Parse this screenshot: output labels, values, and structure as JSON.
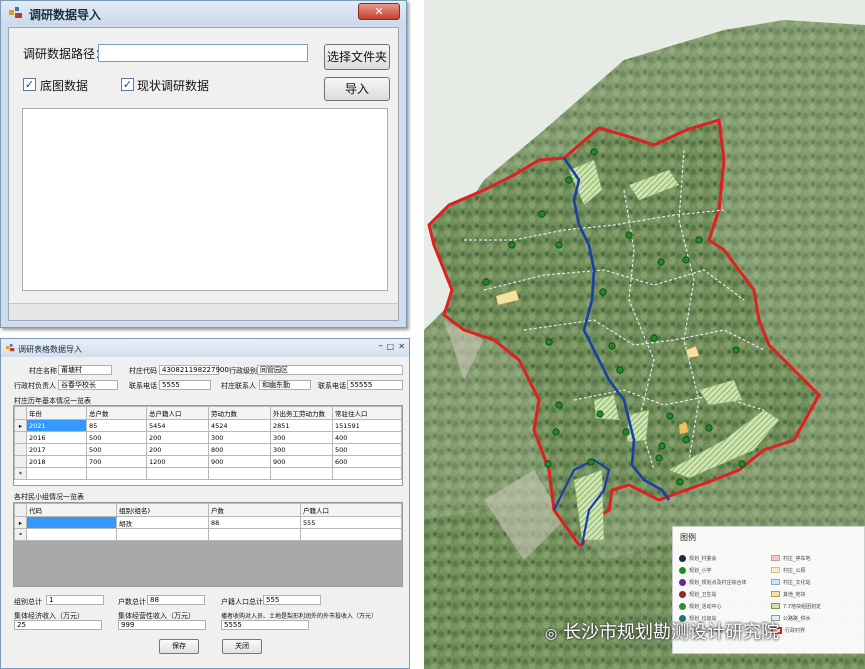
{
  "import_dialog": {
    "title": "调研数据导入",
    "path_label": "调研数据路径：",
    "path_value": "",
    "choose_folder_button": "选择文件夹",
    "import_button": "导入",
    "checkbox_base_map": {
      "label": "底图数据",
      "checked": true
    },
    "checkbox_survey": {
      "label": "现状调研数据",
      "checked": true
    }
  },
  "form_dialog": {
    "title": "调研表格数据导入",
    "village_name_label": "村庄名称",
    "village_name": "莆塘村",
    "village_code_label": "村庄代码",
    "village_code": "430821198227900",
    "admin_label": "行政级别",
    "admin_value": "同管园区",
    "leader_label": "行政村负责人",
    "leader_value": "谷春华校长",
    "phone_label": "联系电话",
    "phone_value": "5555",
    "contact_label": "村庄联系人",
    "contact_value": "和幽东勤",
    "contact_phone_label": "联系电话",
    "contact_phone_value": "55555",
    "table1_title": "村庄历年基本情况一览表",
    "table1_headers": [
      "年份",
      "总户数",
      "总户籍人口",
      "劳动力数",
      "外出务工劳动力数",
      "常驻住人口"
    ],
    "table1_rows": [
      [
        "2021",
        "85",
        "5454",
        "4524",
        "2851",
        "151591"
      ],
      [
        "2016",
        "500",
        "200",
        "300",
        "300",
        "400"
      ],
      [
        "2017",
        "500",
        "200",
        "800",
        "300",
        "500"
      ],
      [
        "2018",
        "700",
        "1200",
        "900",
        "900",
        "600"
      ]
    ],
    "table2_title": "各村民小组情况一览表",
    "table2_headers": [
      "代码",
      "组别(组名)",
      "户数",
      "户籍人口"
    ],
    "table2_rows": [
      [
        "",
        "胡孜",
        "88",
        "555"
      ]
    ],
    "group_total_label": "组别总计",
    "group_total": "1",
    "household_total_label": "户数总计",
    "household_total": "88",
    "population_total_label": "户籍人口总计",
    "population_total": "555",
    "collective_income_label": "集体经济收入（万元）",
    "collective_income": "25",
    "collective_operating_label": "集体经营性收入（万元）",
    "collective_operating": "999",
    "other_income_label": "播者收购对入员、土地是梨形利润外的外市投收入（万元）",
    "other_income": "5555",
    "save_button": "保存",
    "close_button": "关闭"
  },
  "map": {
    "legend_title": "图例",
    "legend_left": [
      "规划_村委会",
      "规划_小学",
      "规划_规划点及村庄综合体",
      "规划_卫生站",
      "规划_活动中心",
      "规划_垃圾站",
      "规划_垃圾设施"
    ],
    "legend_right": [
      "村庄_停车地",
      "村庄_公厕",
      "村庄_文化站",
      "其他_地块",
      "7.7地块组团划定",
      "公路路_供水",
      "行政村界"
    ],
    "watermark": "长沙市规划勘测设计研究院"
  },
  "colors": {
    "boundary": "#e02020",
    "river": "#1a3fa6",
    "poi": "#1f8a23",
    "accent": "#3270c4"
  }
}
